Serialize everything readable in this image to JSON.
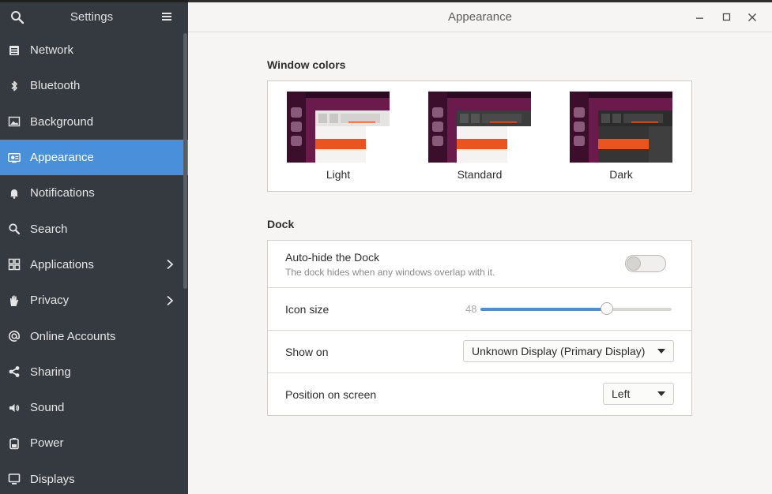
{
  "colors": {
    "accent": "#4a8fd9",
    "sidebar_bg": "#353a40",
    "orange": "#e95420",
    "aubergine": "#3b0f2c"
  },
  "sidebar": {
    "title": "Settings",
    "search_icon": "search-icon",
    "menu_icon": "hamburger-menu-icon",
    "items": [
      {
        "label": "Network",
        "icon": "network-icon"
      },
      {
        "label": "Bluetooth",
        "icon": "bluetooth-icon"
      },
      {
        "label": "Background",
        "icon": "background-icon"
      },
      {
        "label": "Appearance",
        "icon": "appearance-icon",
        "selected": true
      },
      {
        "label": "Notifications",
        "icon": "bell-icon"
      },
      {
        "label": "Search",
        "icon": "search-icon"
      },
      {
        "label": "Applications",
        "icon": "apps-grid-icon",
        "has_submenu": true
      },
      {
        "label": "Privacy",
        "icon": "hand-icon",
        "has_submenu": true
      },
      {
        "label": "Online Accounts",
        "icon": "at-sign-icon"
      },
      {
        "label": "Sharing",
        "icon": "share-icon"
      },
      {
        "label": "Sound",
        "icon": "speaker-icon"
      },
      {
        "label": "Power",
        "icon": "battery-icon"
      },
      {
        "label": "Displays",
        "icon": "display-icon"
      }
    ]
  },
  "header": {
    "title": "Appearance"
  },
  "window_colors": {
    "section_title": "Window colors",
    "themes": [
      {
        "name": "Light"
      },
      {
        "name": "Standard"
      },
      {
        "name": "Dark"
      }
    ]
  },
  "dock": {
    "section_title": "Dock",
    "autohide": {
      "label": "Auto-hide the Dock",
      "description": "The dock hides when any windows overlap with it.",
      "enabled": false
    },
    "icon_size": {
      "label": "Icon size",
      "value": "48",
      "fraction": 0.66
    },
    "show_on": {
      "label": "Show on",
      "selected": "Unknown Display (Primary Display)"
    },
    "position": {
      "label": "Position on screen",
      "selected": "Left"
    }
  }
}
